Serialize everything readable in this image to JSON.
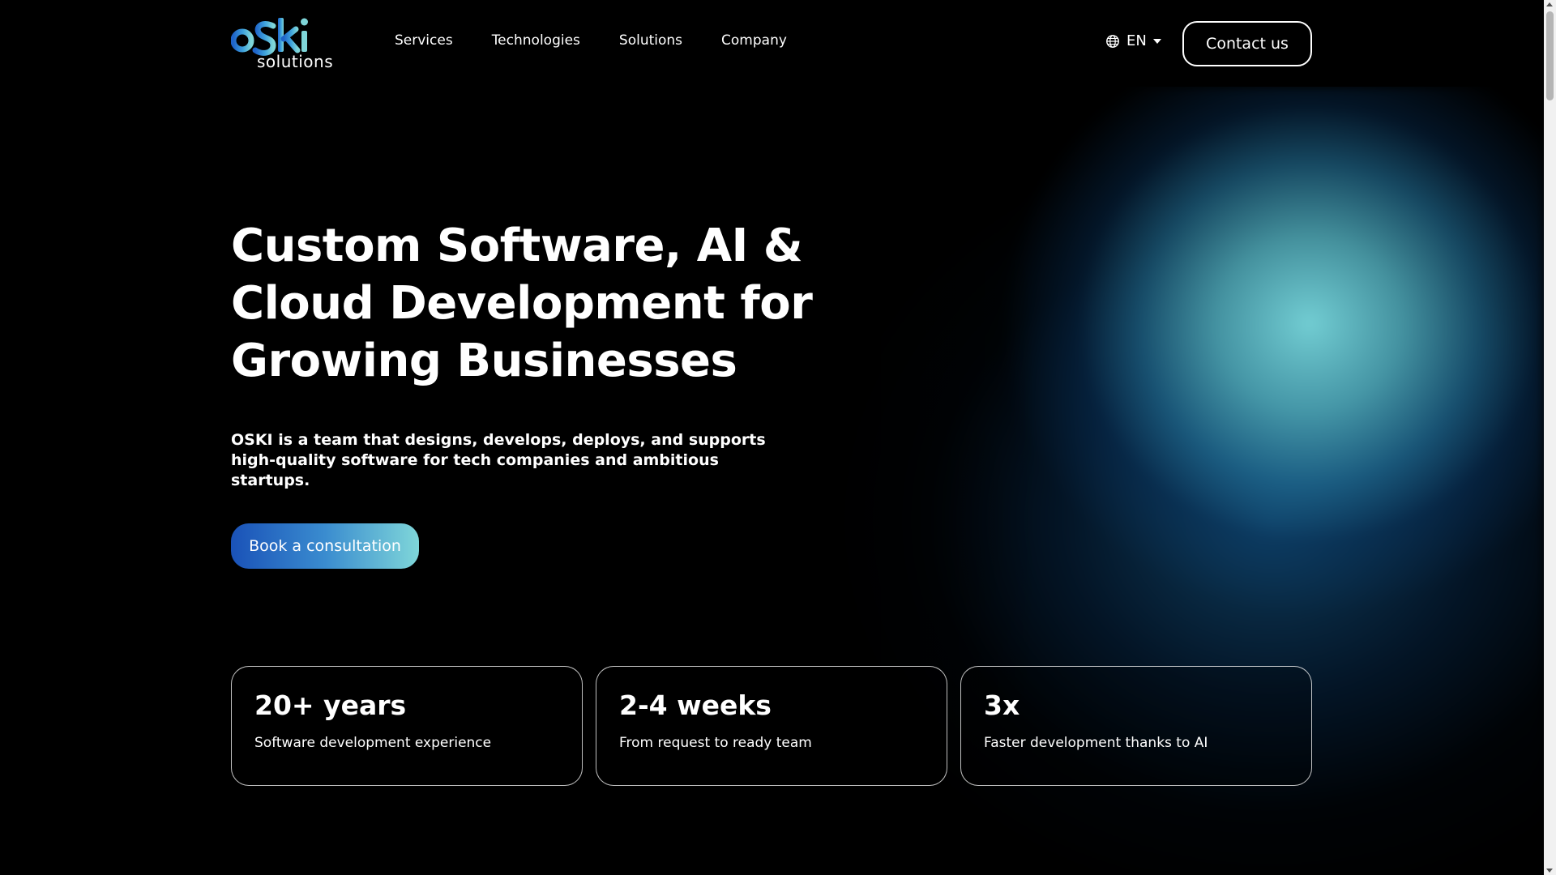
{
  "header": {
    "logo_text": "oSki",
    "logo_subtext": "solutions",
    "nav": [
      {
        "label": "Services"
      },
      {
        "label": "Technologies"
      },
      {
        "label": "Solutions"
      },
      {
        "label": "Company"
      }
    ],
    "language": "EN",
    "contact_label": "Contact us"
  },
  "hero": {
    "title": "Custom Software, AI & Cloud Development for Growing Businesses",
    "description": "OSKI is a team that designs, develops, deploys, and supports high-quality software for tech companies and ambitious startups.",
    "cta_label": "Book a consultation"
  },
  "stats": [
    {
      "value": "20+ years",
      "label": "Software development experience"
    },
    {
      "value": "2-4 weeks",
      "label": "From request to ready team"
    },
    {
      "value": "3x",
      "label": "Faster development thanks to AI"
    }
  ],
  "colors": {
    "background": "#000000",
    "accent_blue": "#1a52b8",
    "accent_cyan": "#7fd6d9",
    "text": "#ffffff"
  },
  "icons": {
    "language": "globe-icon",
    "dropdown": "caret-down-icon"
  }
}
